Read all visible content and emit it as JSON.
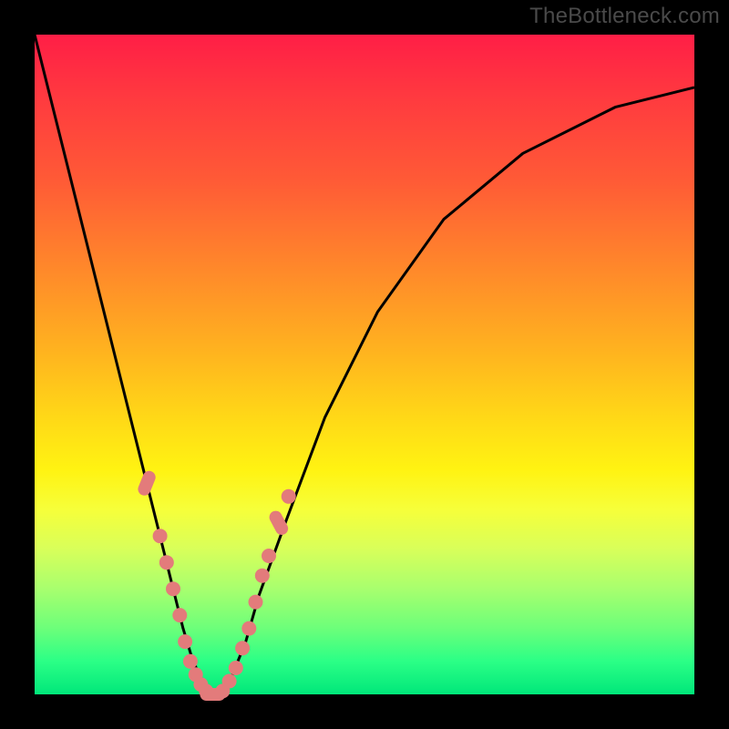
{
  "watermark": "TheBottleneck.com",
  "colors": {
    "frame": "#000000",
    "dot": "#e37b7b",
    "curve": "#000000",
    "gradient_stops": [
      "#ff1e46",
      "#ff3b3f",
      "#ff5a36",
      "#ff8a2a",
      "#ffb31f",
      "#ffd817",
      "#fff312",
      "#f6ff3a",
      "#d8ff5a",
      "#a8ff6e",
      "#6cff7a",
      "#2bff86",
      "#00e77a"
    ]
  },
  "chart_data": {
    "type": "line",
    "title": "",
    "xlabel": "",
    "ylabel": "",
    "xlim": [
      0,
      100
    ],
    "ylim": [
      0,
      100
    ],
    "series": [
      {
        "name": "bottleneck-curve",
        "x": [
          0,
          5,
          10,
          15,
          17,
          19,
          21,
          22.5,
          24,
          25.5,
          27,
          28,
          29,
          30,
          32,
          34,
          38,
          44,
          52,
          62,
          74,
          88,
          100
        ],
        "y": [
          100,
          80,
          60,
          40,
          32,
          24,
          16,
          10,
          5,
          2,
          0,
          0,
          1,
          3,
          8,
          15,
          26,
          42,
          58,
          72,
          82,
          89,
          92
        ]
      }
    ],
    "markers": {
      "name": "highlight-points",
      "points": [
        {
          "x": 17,
          "y": 32,
          "shape": "pill",
          "angle": -68
        },
        {
          "x": 19,
          "y": 24,
          "shape": "dot"
        },
        {
          "x": 20,
          "y": 20,
          "shape": "dot"
        },
        {
          "x": 21,
          "y": 16,
          "shape": "dot"
        },
        {
          "x": 22,
          "y": 12,
          "shape": "dot"
        },
        {
          "x": 22.8,
          "y": 8,
          "shape": "dot"
        },
        {
          "x": 23.6,
          "y": 5,
          "shape": "dot"
        },
        {
          "x": 24.4,
          "y": 3,
          "shape": "dot"
        },
        {
          "x": 25.2,
          "y": 1.5,
          "shape": "dot"
        },
        {
          "x": 26,
          "y": 0.5,
          "shape": "dot"
        },
        {
          "x": 27,
          "y": 0,
          "shape": "pill",
          "angle": 0
        },
        {
          "x": 28.5,
          "y": 0.5,
          "shape": "dot"
        },
        {
          "x": 29.5,
          "y": 2,
          "shape": "dot"
        },
        {
          "x": 30.5,
          "y": 4,
          "shape": "dot"
        },
        {
          "x": 31.5,
          "y": 7,
          "shape": "dot"
        },
        {
          "x": 32.5,
          "y": 10,
          "shape": "dot"
        },
        {
          "x": 33.5,
          "y": 14,
          "shape": "dot"
        },
        {
          "x": 34.5,
          "y": 18,
          "shape": "dot"
        },
        {
          "x": 35.5,
          "y": 21,
          "shape": "dot"
        },
        {
          "x": 37,
          "y": 26,
          "shape": "pill",
          "angle": 62
        },
        {
          "x": 38.5,
          "y": 30,
          "shape": "dot"
        }
      ]
    }
  }
}
